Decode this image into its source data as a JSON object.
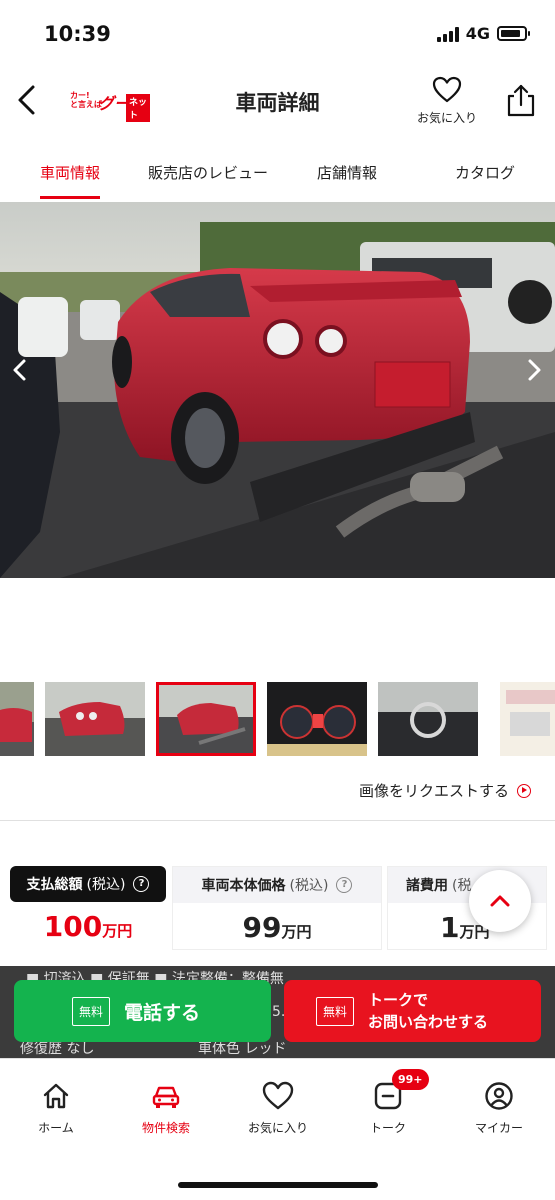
{
  "status_bar": {
    "time": "10:39",
    "network": "4G"
  },
  "header": {
    "logo_small": "カー!\nと言えば",
    "logo_goo": "グー",
    "logo_net": "ネット",
    "title": "車両詳細",
    "favorite_label": "お気に入り"
  },
  "tabs": [
    {
      "label": "車両情報",
      "active": true
    },
    {
      "label": "販売店のレビュー",
      "active": false
    },
    {
      "label": "店舗情報",
      "active": false
    },
    {
      "label": "カタログ",
      "active": false
    }
  ],
  "gallery": {
    "request_label": "画像をリクエストする",
    "selected_index": 2
  },
  "prices": {
    "total": {
      "label": "支払総額",
      "tax": "(税込)",
      "value": "100",
      "unit": "万円"
    },
    "body": {
      "label": "車両本体価格",
      "tax": "(税込)",
      "value": "99",
      "unit": "万円"
    },
    "fees": {
      "label": "諸費用",
      "tax": "(税",
      "value": "1",
      "unit": "万円"
    }
  },
  "behind_text": {
    "line1": "■ 切済込 ■ 保証無 ■ 法定整備：整備無",
    "line2_left": "修復歴 なし",
    "line2_right": "車体色 レッド",
    "frag": "5."
  },
  "cta": {
    "call_tag": "無料",
    "call_label": "電話する",
    "talk_tag": "無料",
    "talk_line1": "トークで",
    "talk_line2": "お問い合わせする"
  },
  "bottom_nav": [
    {
      "label": "ホーム",
      "icon": "home-icon",
      "active": false
    },
    {
      "label": "物件検索",
      "icon": "car-icon",
      "active": true
    },
    {
      "label": "お気に入り",
      "icon": "heart-icon",
      "active": false
    },
    {
      "label": "トーク",
      "icon": "talk-icon",
      "active": false,
      "badge": "99+"
    },
    {
      "label": "マイカー",
      "icon": "user-icon",
      "active": false
    }
  ],
  "colors": {
    "accent": "#e60012",
    "green": "#14b34e",
    "cta_red": "#e8131f"
  }
}
